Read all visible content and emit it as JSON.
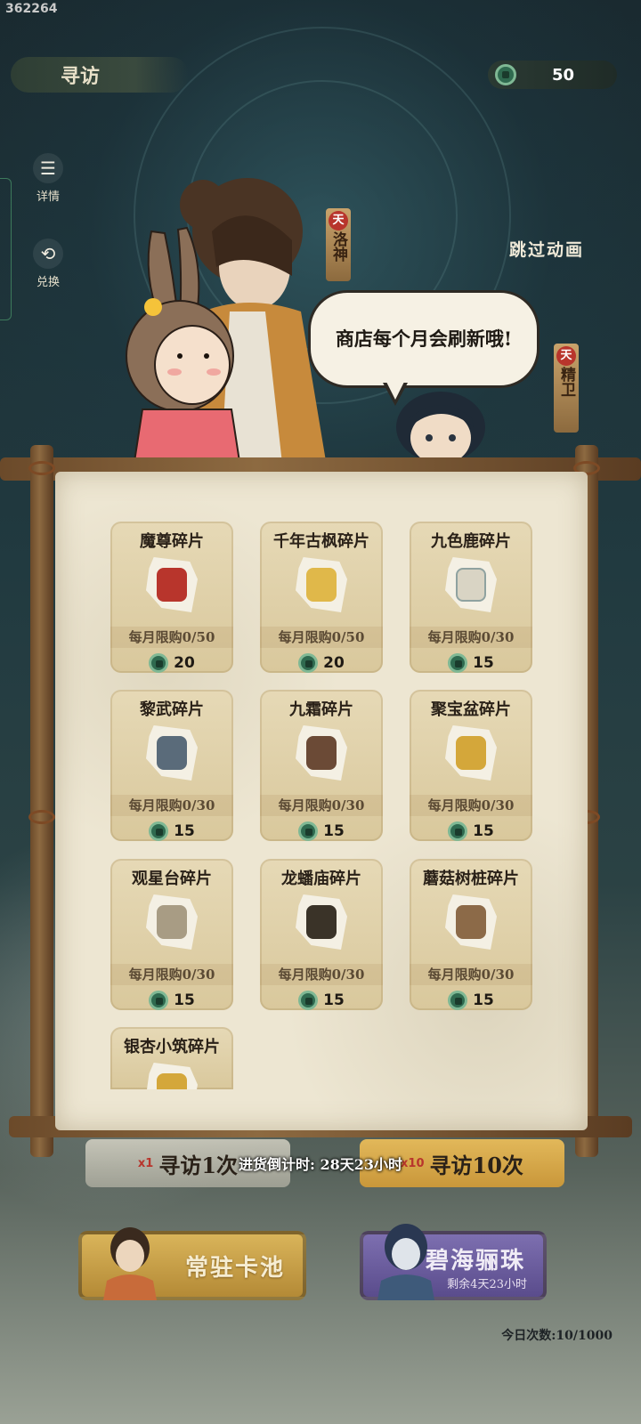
{
  "build_id": "362264",
  "header": {
    "title": "寻访",
    "currency_amount": "50",
    "currency_icon": "jade-coin-icon"
  },
  "side_buttons": [
    {
      "label": "详情",
      "icon": "list-icon"
    },
    {
      "label": "兑换",
      "icon": "exchange-icon"
    }
  ],
  "skip_label": "跳过动画",
  "banners": [
    {
      "stamp": "天",
      "text": "洛神"
    },
    {
      "stamp": "天",
      "text": "精卫"
    }
  ],
  "speech": "商店每个月会刷新哦!",
  "shop": {
    "items": [
      {
        "name": "魔尊碎片",
        "limit": "每月限购0/50",
        "price": "20",
        "color": "#b8352c"
      },
      {
        "name": "千年古枫碎片",
        "limit": "每月限购0/50",
        "price": "20",
        "color": "#e0b84a"
      },
      {
        "name": "九色鹿碎片",
        "limit": "每月限购0/30",
        "price": "15",
        "color": "#d9d4c4"
      },
      {
        "name": "黎武碎片",
        "limit": "每月限购0/30",
        "price": "15",
        "color": "#5a6b7a"
      },
      {
        "name": "九霜碎片",
        "limit": "每月限购0/30",
        "price": "15",
        "color": "#6b4a36"
      },
      {
        "name": "聚宝盆碎片",
        "limit": "每月限购0/30",
        "price": "15",
        "color": "#d4a73a"
      },
      {
        "name": "观星台碎片",
        "limit": "每月限购0/30",
        "price": "15",
        "color": "#a89c84"
      },
      {
        "name": "龙蟠庙碎片",
        "limit": "每月限购0/30",
        "price": "15",
        "color": "#3a3328"
      },
      {
        "name": "蘑菇树桩碎片",
        "limit": "每月限购0/30",
        "price": "15",
        "color": "#8c6a48"
      },
      {
        "name": "银杏小筑碎片",
        "limit": "",
        "price": "",
        "color": "#d4a73a"
      }
    ]
  },
  "gacha": {
    "single_tag": "x1",
    "single_label": "寻访1次",
    "ten_tag": "x10",
    "ten_label": "寻访10次"
  },
  "countdown": "进货倒计时: 28天23小时",
  "pools": {
    "standard": {
      "label": "常驻卡池"
    },
    "limited": {
      "label": "碧海骊珠",
      "remaining": "剩余4天23小时"
    }
  },
  "today_count": "今日次数:10/1000"
}
